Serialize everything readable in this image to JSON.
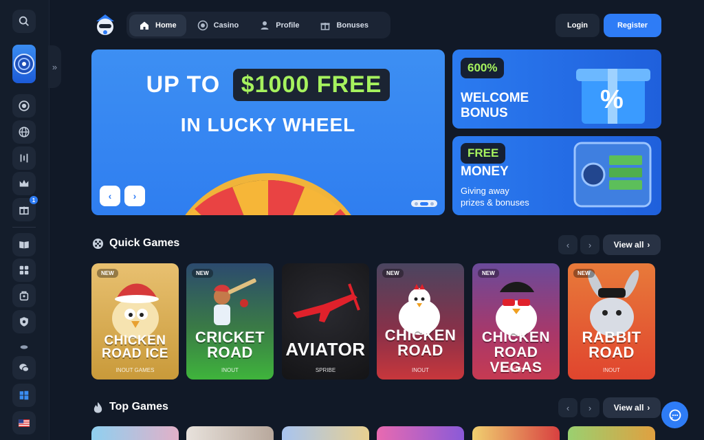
{
  "nav": {
    "items": [
      {
        "label": "Home",
        "icon": "home-icon",
        "active": true
      },
      {
        "label": "Casino",
        "icon": "chip-icon",
        "active": false
      },
      {
        "label": "Profile",
        "icon": "user-icon",
        "active": false
      },
      {
        "label": "Bonuses",
        "icon": "gift-icon",
        "active": false
      }
    ]
  },
  "auth": {
    "login": "Login",
    "register": "Register"
  },
  "sidebar": {
    "icons": [
      "search-icon",
      "lucky-wheel-icon",
      "chip-icon",
      "globe-icon",
      "chart-icon",
      "crown-icon",
      "gift-icon",
      "book-icon",
      "puzzle-icon",
      "bag-icon",
      "shield-icon",
      "coins-icon",
      "chat-bubbles-icon",
      "windows-icon",
      "us-flag-icon"
    ],
    "gift_badge": "1"
  },
  "hero": {
    "line1_prefix": "UP TO",
    "line1_highlight": "$1000 FREE",
    "line2": "IN LUCKY WHEEL"
  },
  "promos": [
    {
      "tag": "600%",
      "title_line1": "WELCOME",
      "title_line2": "BONUS"
    },
    {
      "tag": "FREE",
      "title_line1": "MONEY",
      "sub_line1": "Giving away",
      "sub_line2": "prizes & bonuses"
    }
  ],
  "sections": {
    "quick": {
      "title": "Quick Games",
      "view_all": "View all"
    },
    "top": {
      "title": "Top Games",
      "view_all": "View all"
    }
  },
  "games": [
    {
      "title1": "CHICKEN",
      "title2": "ROAD ICE",
      "provider": "INOUT GAMES",
      "new": "NEW",
      "bg": "#c99a3a"
    },
    {
      "title1": "CRICKET",
      "title2": "ROAD",
      "provider": "INOUT",
      "new": "NEW",
      "bg": "#3fb43c"
    },
    {
      "title1": "AVIATOR",
      "title2": "",
      "provider": "SPRIBE",
      "new": "",
      "bg": "#1a1a1f"
    },
    {
      "title1": "CHICKEN",
      "title2": "ROAD",
      "provider": "INOUT",
      "new": "NEW",
      "bg": "#c8373c"
    },
    {
      "title1": "CHICKEN",
      "title2": "ROAD VEGAS",
      "provider": "INOUT",
      "new": "NEW",
      "bg": "#c63a52"
    },
    {
      "title1": "RABBIT",
      "title2": "ROAD",
      "provider": "INOUT",
      "new": "NEW",
      "bg": "#e0452e"
    }
  ],
  "colors": {
    "accent": "#2e7cf6",
    "highlight": "#a6f25e",
    "bg": "#111927"
  }
}
